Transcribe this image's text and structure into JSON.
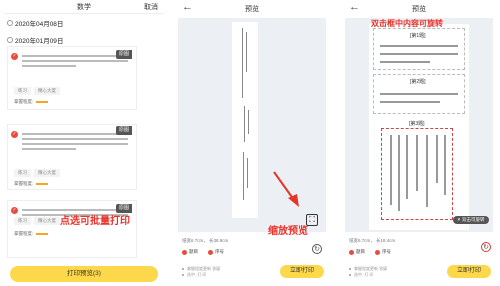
{
  "panel1": {
    "title": "数学",
    "cancel_label": "取消",
    "dates": [
      "2020年04月08日",
      "2020年01月09日"
    ],
    "card_chips": [
      "练习",
      "精心大度"
    ],
    "master_label": "掌握程度:",
    "origin_label": "原图",
    "caption": "点选可批量打印",
    "preview_button": "打印预览(3)"
  },
  "panel2": {
    "title": "预览",
    "size_text": "纸宽6.7cm，  长38.9cm",
    "options": [
      "题目",
      "序号"
    ],
    "notes": [
      "掌握程度更新 答疑",
      "选中, 打 印"
    ],
    "print_button": "立即打印",
    "caption": "缩放预览"
  },
  "panel3": {
    "title": "预览",
    "caption": "双击框中内容可旋转",
    "questions": [
      "[第1题]",
      "[第2题]",
      "[第3题]"
    ],
    "size_text": "纸宽6.7cm，  长18.4cm",
    "tip": "双击可旋转",
    "options": [
      "题目",
      "序号"
    ],
    "notes": [
      "掌握程度更新 答疑",
      "选中, 打 印"
    ],
    "print_button": "立即打印"
  },
  "colors": {
    "accent": "#fcd84a",
    "caption_red": "#e8332a",
    "check_red": "#e94b3c"
  },
  "icons": [
    "back-arrow-icon",
    "fit-screen-icon",
    "rotate-icon",
    "check-icon",
    "close-icon"
  ]
}
